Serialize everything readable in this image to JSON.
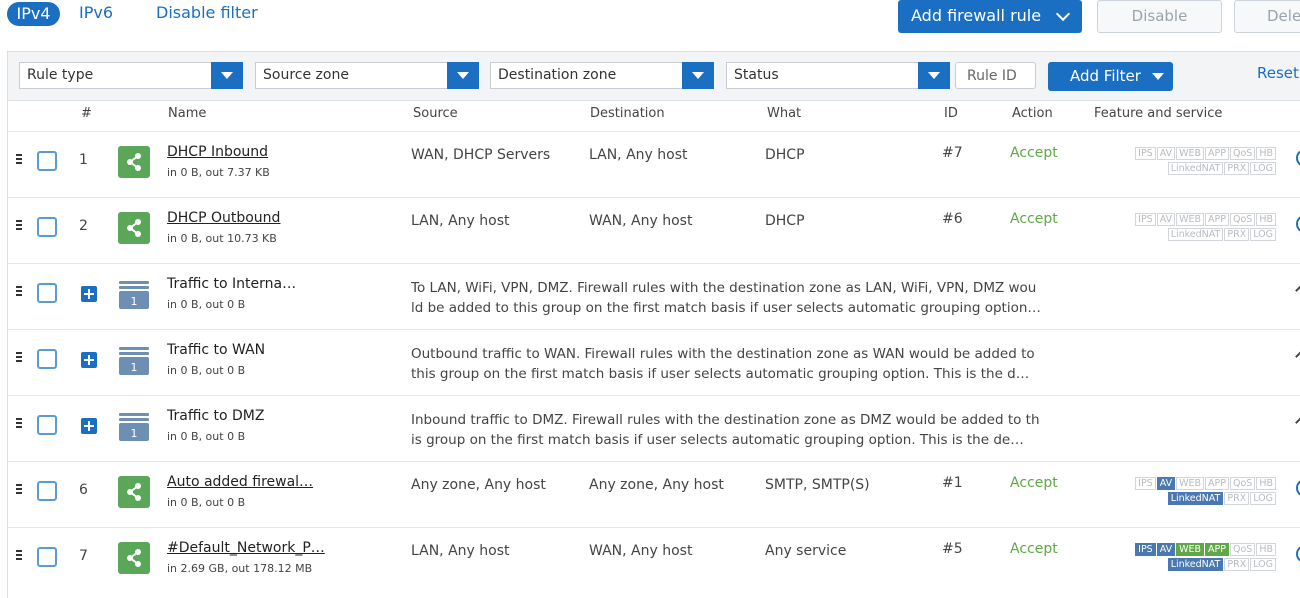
{
  "tabs": {
    "ipv4": "IPv4",
    "ipv6": "IPv6",
    "disable_filter": "Disable filter"
  },
  "actions": {
    "add_rule": "Add firewall rule",
    "disable": "Disable",
    "delete": "Dele"
  },
  "filters": {
    "rule_type": "Rule type",
    "source_zone": "Source zone",
    "destination_zone": "Destination zone",
    "status": "Status",
    "rule_id_placeholder": "Rule ID",
    "add_filter": "Add Filter",
    "reset": "Reset"
  },
  "columns": {
    "num": "#",
    "name": "Name",
    "source": "Source",
    "destination": "Destination",
    "what": "What",
    "id": "ID",
    "action": "Action",
    "feature": "Feature and service"
  },
  "colors": {
    "accent": "#1a6fc2",
    "accept": "#5fa845",
    "rule_icon": "#5ba75a",
    "badge_on": "#4a78b0"
  },
  "rows": [
    {
      "num": "1",
      "name": "DHCP Inbound",
      "traffic": "in 0 B, out 7.37 KB",
      "source": "WAN, DHCP Servers",
      "destination": "LAN, Any host",
      "what": "DHCP",
      "id": "#7",
      "action": "Accept"
    },
    {
      "num": "2",
      "name": "DHCP Outbound",
      "traffic": "in 0 B, out 10.73 KB",
      "source": "LAN, Any host",
      "destination": "WAN, Any host",
      "what": "DHCP",
      "id": "#6",
      "action": "Accept"
    },
    {
      "name": "Traffic to Interna…",
      "traffic": "in 0 B, out 0 B",
      "desc_line1": "To LAN, WiFi, VPN, DMZ. Firewall rules with the destination zone as LAN, WiFi, VPN, DMZ wou",
      "desc_line2": "ld be added to this group on the first match basis if user selects automatic grouping option…",
      "count": "1"
    },
    {
      "name": "Traffic to WAN",
      "traffic": "in 0 B, out 0 B",
      "desc_line1": "Outbound traffic to WAN. Firewall rules with the destination zone as WAN would be added to",
      "desc_line2": "this group on the first match basis if user selects automatic grouping option. This is the d…",
      "count": "1"
    },
    {
      "name": "Traffic to DMZ",
      "traffic": "in 0 B, out 0 B",
      "desc_line1": "Inbound traffic to DMZ. Firewall rules with the destination zone as DMZ would be added to th",
      "desc_line2": "is group on the first match basis if user selects automatic grouping option. This is the de…",
      "count": "1"
    },
    {
      "num": "6",
      "name": "Auto added firewal…",
      "traffic": "in 0 B, out 0 B",
      "source": "Any zone, Any host",
      "destination": "Any zone, Any host",
      "what": "SMTP, SMTP(S)",
      "id": "#1",
      "action": "Accept"
    },
    {
      "num": "7",
      "name": "#Default_Network_P…",
      "traffic": "in 2.69 GB, out 178.12 MB",
      "source": "LAN, Any host",
      "destination": "WAN, Any host",
      "what": "Any service",
      "id": "#5",
      "action": "Accept"
    }
  ],
  "badges": {
    "ips": "IPS",
    "av": "AV",
    "web": "WEB",
    "app": "APP",
    "qos": "QoS",
    "hb": "HB",
    "linkednat": "LinkedNAT",
    "prx": "PRX",
    "log": "LOG"
  }
}
